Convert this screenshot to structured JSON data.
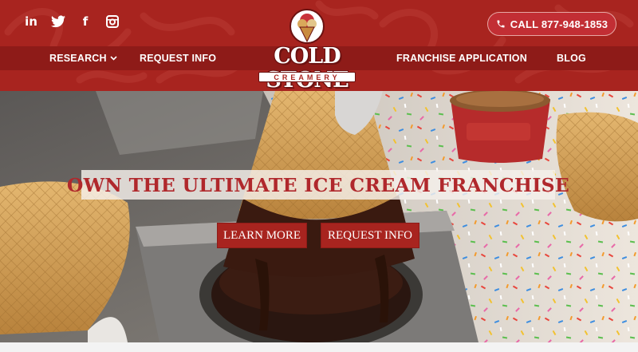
{
  "header": {
    "social": [
      {
        "icon": "linkedin-icon",
        "glyph": "in"
      },
      {
        "icon": "twitter-icon",
        "glyph": "t"
      },
      {
        "icon": "facebook-icon",
        "glyph": "f"
      },
      {
        "icon": "instagram-icon",
        "glyph": "◎"
      }
    ],
    "call_label": "CALL 877-948-1853",
    "nav": {
      "research": "RESEARCH",
      "request_info": "REQUEST INFO",
      "franchise_application": "FRANCHISE APPLICATION",
      "blog": "BLOG"
    },
    "logo": {
      "word": "COLD STONE",
      "sub": "CREAMERY"
    }
  },
  "hero": {
    "headline": "OWN THE ULTIMATE ICE CREAM FRANCHISE",
    "learn_more": "LEARN MORE",
    "request_info": "REQUEST INFO"
  },
  "colors": {
    "brand_red": "#a8241f",
    "nav_band": "#8e1b18",
    "headline_red": "#b0282c"
  }
}
